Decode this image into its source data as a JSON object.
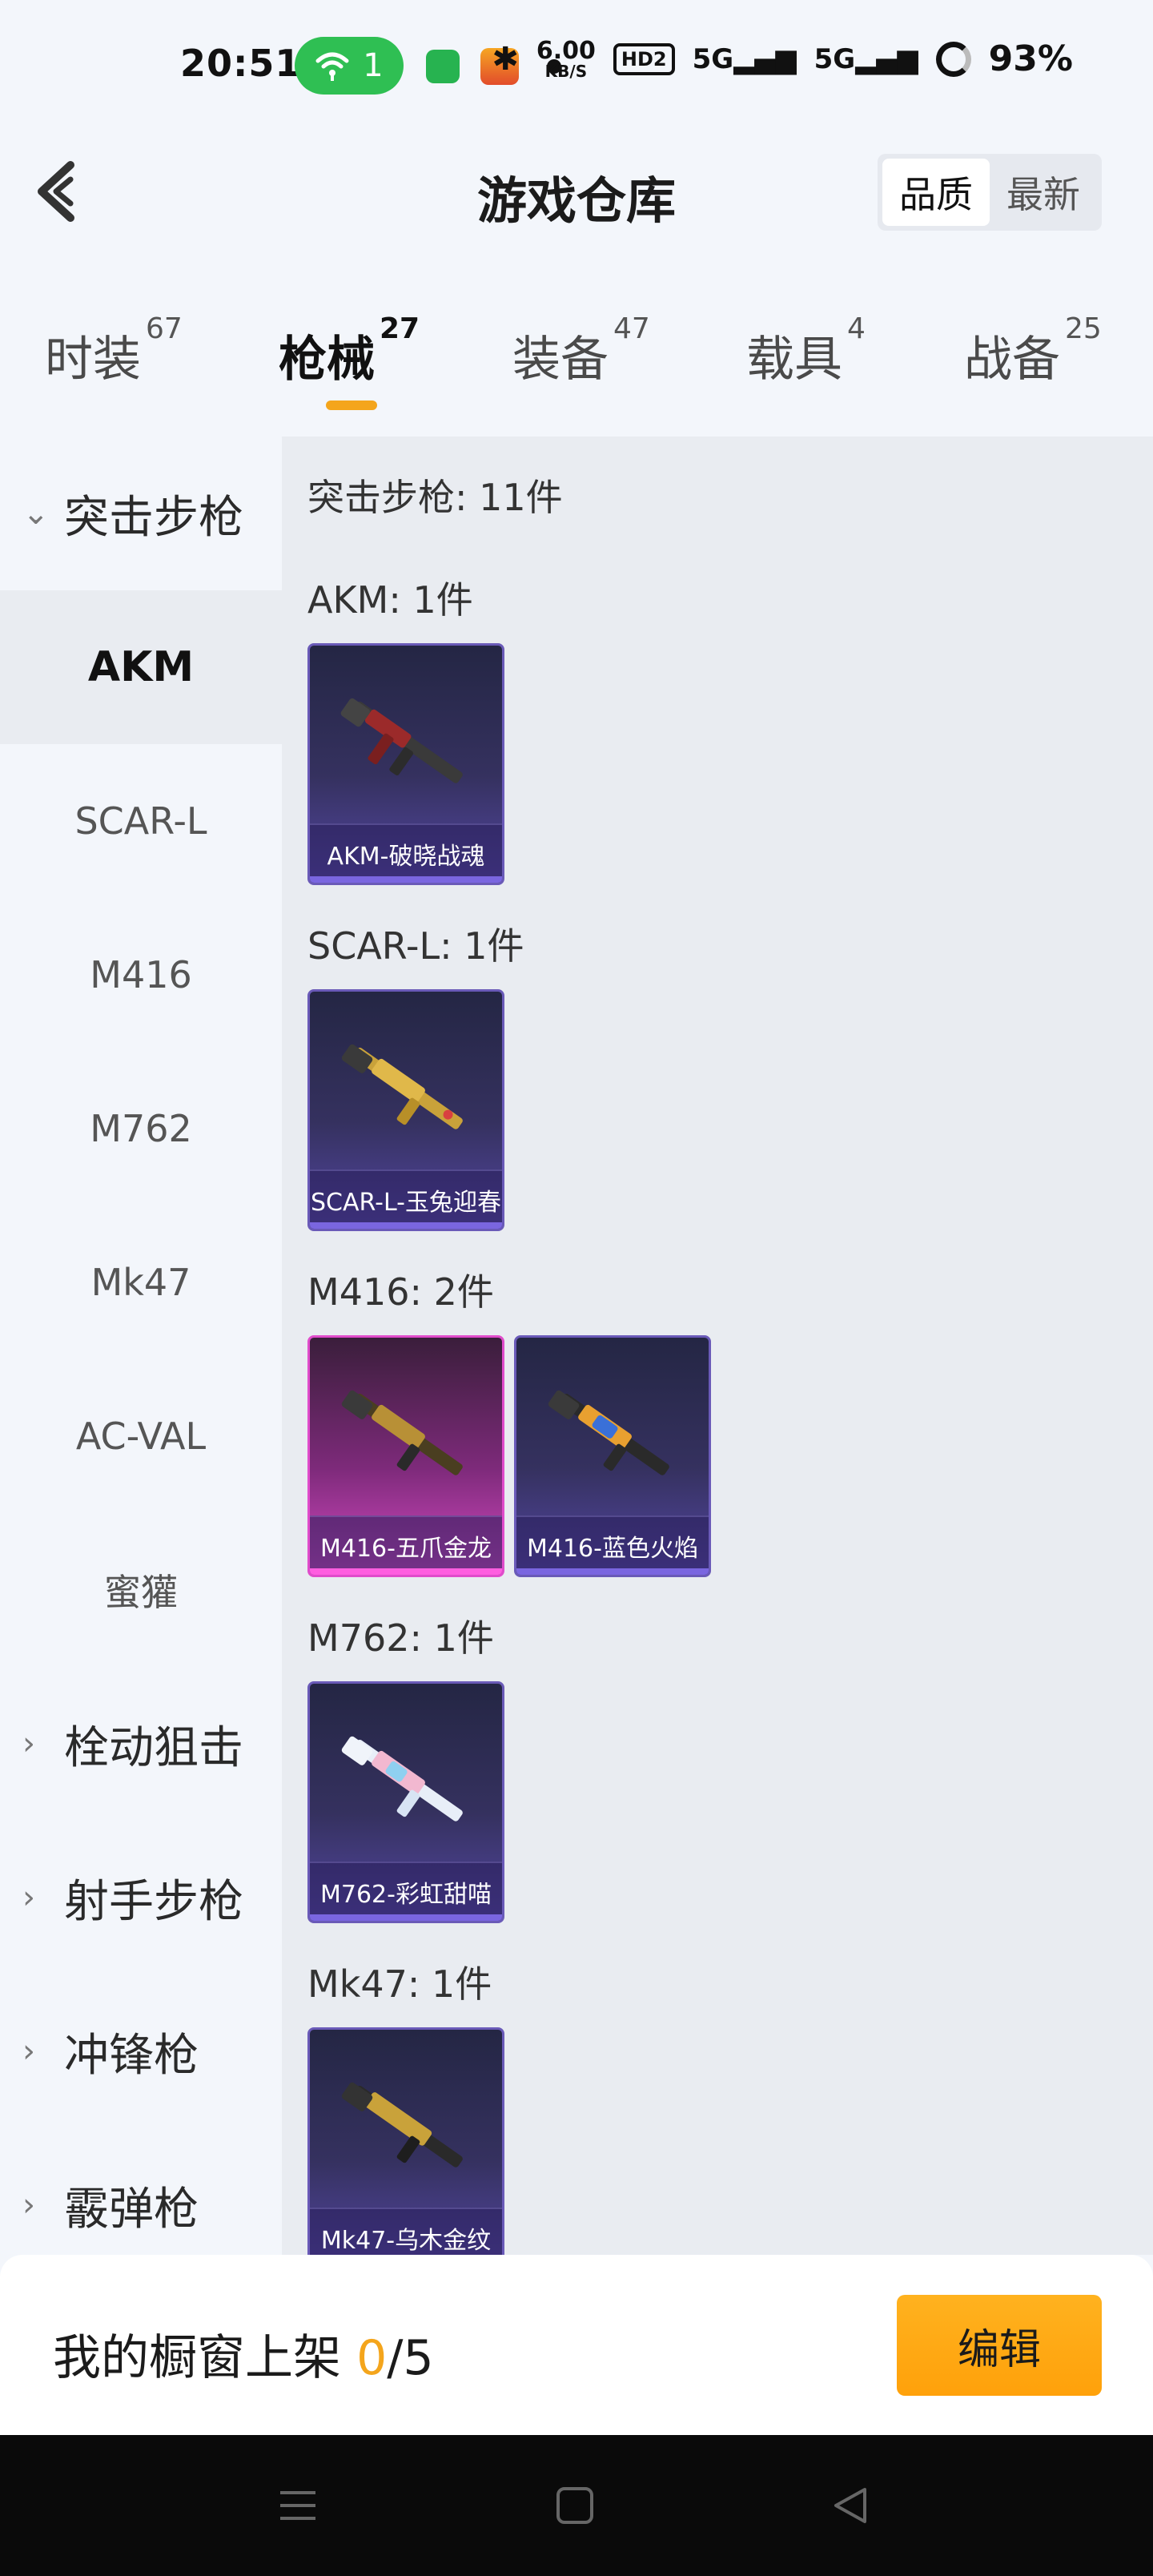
{
  "status_bar": {
    "time": "20:51",
    "wifi_count": "1",
    "speed_value": "6.00",
    "speed_unit": "KB/S",
    "hd_badge": "HD2",
    "signal_5g_1": "5G",
    "signal_5g_2": "5G",
    "battery": "93%"
  },
  "header": {
    "title": "游戏仓库",
    "sort_options": [
      "品质",
      "最新"
    ],
    "sort_active": "品质"
  },
  "tabs": [
    {
      "label": "时装",
      "count": "67"
    },
    {
      "label": "枪械",
      "count": "27",
      "active": true
    },
    {
      "label": "装备",
      "count": "47"
    },
    {
      "label": "载具",
      "count": "4"
    },
    {
      "label": "战备",
      "count": "25"
    }
  ],
  "sidebar": {
    "expanded_group": "突击步枪",
    "sub_items": [
      "AKM",
      "SCAR-L",
      "M416",
      "M762",
      "Mk47",
      "AC-VAL",
      "蜜獾"
    ],
    "active_sub_item": "AKM",
    "collapsed_groups": [
      "栓动狙击",
      "射手步枪",
      "冲锋枪",
      "霰弹枪"
    ]
  },
  "content": {
    "section_total": "突击步枪: 11件",
    "categories": [
      {
        "title": "AKM: 1件",
        "items": [
          "AKM-破晓战魂"
        ]
      },
      {
        "title": "SCAR-L: 1件",
        "items": [
          "SCAR-L-玉兔迎春"
        ]
      },
      {
        "title": "M416: 2件",
        "items": [
          "M416-五爪金龙",
          "M416-蓝色火焰"
        ]
      },
      {
        "title": "M762: 1件",
        "items": [
          "M762-彩虹甜喵"
        ]
      },
      {
        "title": "Mk47: 1件",
        "items": [
          "Mk47-乌木金纹"
        ]
      }
    ]
  },
  "showcase": {
    "label": "我的橱窗上架 ",
    "current": "0",
    "total": "/5",
    "edit_label": "编辑"
  },
  "colors": {
    "accent": "#f4a51c",
    "card_purple": "#5447a3",
    "card_pink": "#d64ac3"
  }
}
